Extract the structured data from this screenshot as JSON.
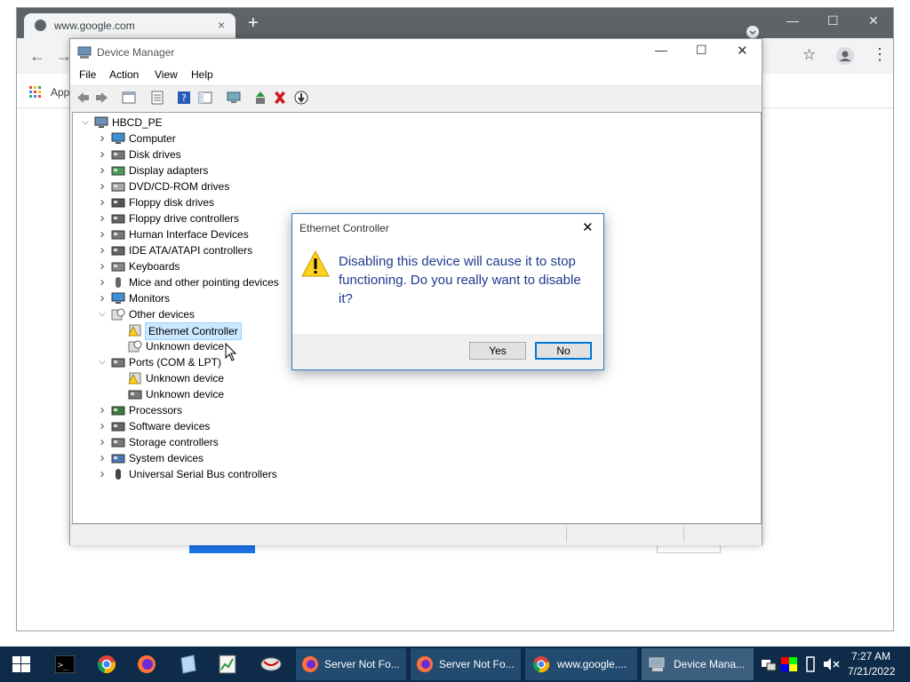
{
  "chrome": {
    "tab_title": "www.google.com",
    "tab_close": "×",
    "new_tab": "+",
    "bookmark_apps": "App"
  },
  "device_manager": {
    "title": "Device Manager",
    "menu": [
      "File",
      "Action",
      "View",
      "Help"
    ],
    "tree": [
      {
        "label": "HBCD_PE",
        "level": 0,
        "expanded": true,
        "icon": "computer-icon"
      },
      {
        "label": "Computer",
        "level": 1,
        "expanded": false,
        "icon": "monitor-icon"
      },
      {
        "label": "Disk drives",
        "level": 1,
        "expanded": false,
        "icon": "disk-icon"
      },
      {
        "label": "Display adapters",
        "level": 1,
        "expanded": false,
        "icon": "display-adapter-icon"
      },
      {
        "label": "DVD/CD-ROM drives",
        "level": 1,
        "expanded": false,
        "icon": "dvd-icon"
      },
      {
        "label": "Floppy disk drives",
        "level": 1,
        "expanded": false,
        "icon": "floppy-icon"
      },
      {
        "label": "Floppy drive controllers",
        "level": 1,
        "expanded": false,
        "icon": "controller-icon"
      },
      {
        "label": "Human Interface Devices",
        "level": 1,
        "expanded": false,
        "icon": "hid-icon"
      },
      {
        "label": "IDE ATA/ATAPI controllers",
        "level": 1,
        "expanded": false,
        "icon": "ide-icon"
      },
      {
        "label": "Keyboards",
        "level": 1,
        "expanded": false,
        "icon": "keyboard-icon"
      },
      {
        "label": "Mice and other pointing devices",
        "level": 1,
        "expanded": false,
        "icon": "mouse-icon"
      },
      {
        "label": "Monitors",
        "level": 1,
        "expanded": false,
        "icon": "monitor-icon"
      },
      {
        "label": "Other devices",
        "level": 1,
        "expanded": true,
        "icon": "unknown-device-icon"
      },
      {
        "label": "Ethernet Controller",
        "level": 2,
        "selected": true,
        "icon": "warning-device-icon"
      },
      {
        "label": "Unknown device",
        "level": 2,
        "icon": "unknown-device-icon"
      },
      {
        "label": "Ports (COM & LPT)",
        "level": 1,
        "expanded": true,
        "icon": "port-icon"
      },
      {
        "label": "Unknown device",
        "level": 2,
        "icon": "warning-device-icon"
      },
      {
        "label": "Unknown device",
        "level": 2,
        "icon": "port-icon"
      },
      {
        "label": "Processors",
        "level": 1,
        "expanded": false,
        "icon": "processor-icon"
      },
      {
        "label": "Software devices",
        "level": 1,
        "expanded": false,
        "icon": "software-icon"
      },
      {
        "label": "Storage controllers",
        "level": 1,
        "expanded": false,
        "icon": "storage-icon"
      },
      {
        "label": "System devices",
        "level": 1,
        "expanded": false,
        "icon": "system-icon"
      },
      {
        "label": "Universal Serial Bus controllers",
        "level": 1,
        "expanded": false,
        "icon": "usb-icon"
      }
    ]
  },
  "dialog": {
    "title": "Ethernet Controller",
    "message": "Disabling this device will cause it to stop functioning. Do you really want to disable it?",
    "yes": "Yes",
    "no": "No",
    "close": "✕"
  },
  "taskbar": {
    "buttons": [
      "Server Not Fo...",
      "Server Not Fo...",
      "www.google....",
      "Device Mana..."
    ],
    "time": "7:27 AM",
    "date": "7/21/2022"
  },
  "colors": {
    "accent": "#0078d7",
    "dialog_text": "#1e3a8c",
    "selection": "#cce8ff",
    "taskbar": "#0e2c4a"
  }
}
